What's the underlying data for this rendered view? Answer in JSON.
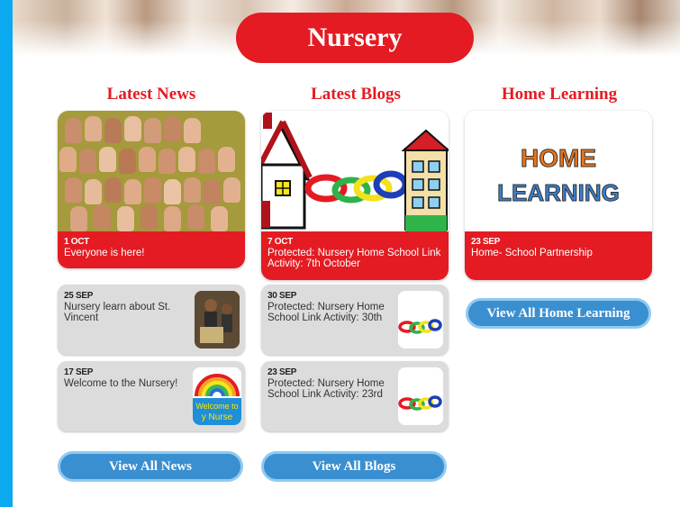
{
  "page": {
    "title": "Nursery"
  },
  "columns": [
    {
      "heading": "Latest News",
      "featured": {
        "date": "1 OCT",
        "title": "Everyone is here!"
      },
      "items": [
        {
          "date": "25 SEP",
          "title": "Nursery learn about St. Vincent"
        },
        {
          "date": "17 SEP",
          "title": "Welcome to the Nursery!"
        }
      ],
      "button": "View All News"
    },
    {
      "heading": "Latest Blogs",
      "featured": {
        "date": "7 OCT",
        "title": "Protected: Nursery Home School Link Activity: 7th October"
      },
      "items": [
        {
          "date": "30 SEP",
          "title": "Protected: Nursery Home School Link Activity: 30th"
        },
        {
          "date": "23 SEP",
          "title": "Protected: Nursery Home School Link Activity: 23rd"
        }
      ],
      "button": "View All Blogs"
    },
    {
      "heading": "Home Learning",
      "featured": {
        "date": "23 SEP",
        "title": "Home- School Partnership",
        "image_text_line1": "HOME",
        "image_text_line2": "LEARNING"
      },
      "items": [],
      "button": "View All Home Learning"
    }
  ],
  "thumb_text": {
    "welcome_line1": "Welcome to",
    "welcome_line2": "y Nurse"
  },
  "colors": {
    "accent_red": "#e41b22",
    "button_blue": "#3a8fd0",
    "left_bar": "#0aa9f0"
  }
}
